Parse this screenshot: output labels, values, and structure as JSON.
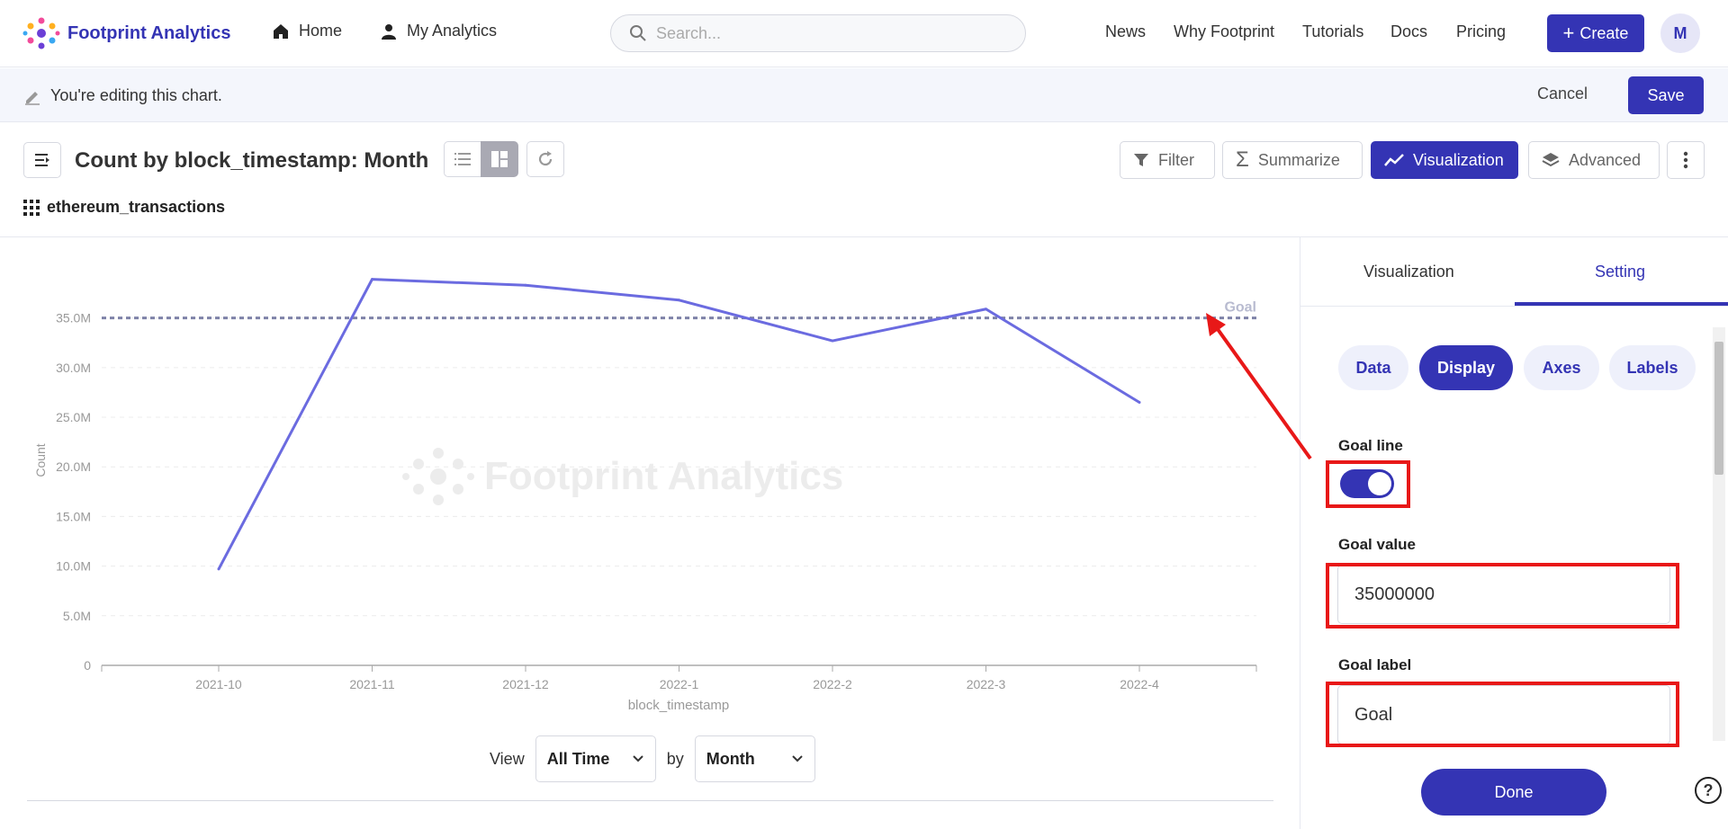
{
  "nav": {
    "brand": "Footprint Analytics",
    "home": "Home",
    "my_analytics": "My Analytics",
    "search_placeholder": "Search...",
    "links": [
      "News",
      "Why Footprint",
      "Tutorials",
      "Docs",
      "Pricing"
    ],
    "create": "Create",
    "avatar": "M"
  },
  "editbar": {
    "message": "You're editing this chart.",
    "cancel": "Cancel",
    "save": "Save"
  },
  "header": {
    "title": "Count by block_timestamp: Month",
    "dataset": "ethereum_transactions",
    "filter": "Filter",
    "summarize": "Summarize",
    "visualization": "Visualization",
    "advanced": "Advanced"
  },
  "chart_data": {
    "type": "line",
    "categories": [
      "2021-10",
      "2021-11",
      "2021-12",
      "2022-1",
      "2022-2",
      "2022-3",
      "2022-4"
    ],
    "series": [
      {
        "values": [
          9700000,
          38900000,
          38300000,
          36800000,
          32700000,
          35900000,
          26500000
        ]
      }
    ],
    "xlabel": "block_timestamp",
    "ylabel": "Count",
    "ylim": [
      0,
      35000000
    ],
    "yticks": [
      "0",
      "5.0M",
      "10.0M",
      "15.0M",
      "20.0M",
      "25.0M",
      "30.0M",
      "35.0M"
    ],
    "goal": {
      "value": 35000000,
      "label": "Goal"
    },
    "watermark": "Footprint Analytics",
    "line_color": "#6b6be0",
    "grid": true
  },
  "view": {
    "label": "View",
    "range": "All Time",
    "by": "by",
    "unit": "Month"
  },
  "panel": {
    "tabs": [
      "Visualization",
      "Setting"
    ],
    "pills": [
      "Data",
      "Display",
      "Axes",
      "Labels"
    ],
    "goal_line_label": "Goal line",
    "goal_value_label": "Goal value",
    "goal_value": "35000000",
    "goal_label_label": "Goal label",
    "goal_label": "Goal",
    "done": "Done",
    "help": "?"
  },
  "colors": {
    "accent": "#3434b4",
    "highlight": "#e81818"
  }
}
